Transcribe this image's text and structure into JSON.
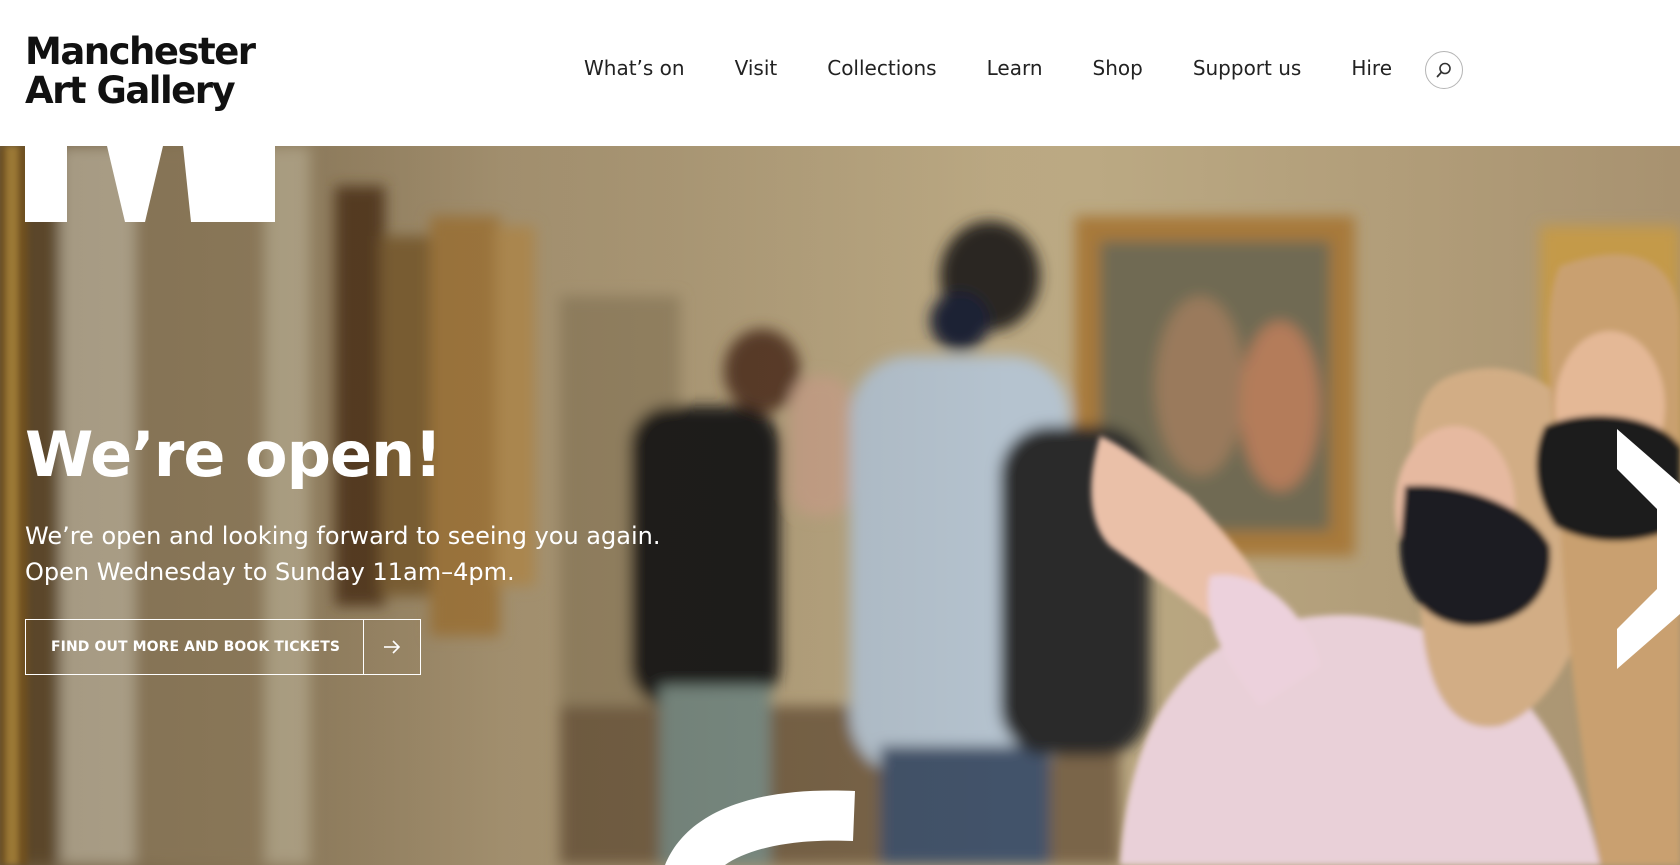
{
  "logo": {
    "line1": "Manchester",
    "line2": "Art Gallery"
  },
  "nav": {
    "items": [
      {
        "label": "What’s on"
      },
      {
        "label": "Visit"
      },
      {
        "label": "Collections"
      },
      {
        "label": "Learn"
      },
      {
        "label": "Shop"
      },
      {
        "label": "Support us"
      },
      {
        "label": "Hire"
      }
    ],
    "search_icon": "search-icon"
  },
  "hero": {
    "title": "We’re open!",
    "line1": "We’re open and looking forward to seeing you again.",
    "line2": "Open Wednesday to Sunday 11am–4pm.",
    "cta_label": "FIND OUT MORE AND BOOK TICKETS",
    "cta_icon": "arrow-right-icon",
    "image": "gallery-visitors-photo"
  },
  "colors": {
    "text_dark": "#1a1a1a",
    "hero_text": "#ffffff",
    "header_bg": "#ffffff"
  }
}
